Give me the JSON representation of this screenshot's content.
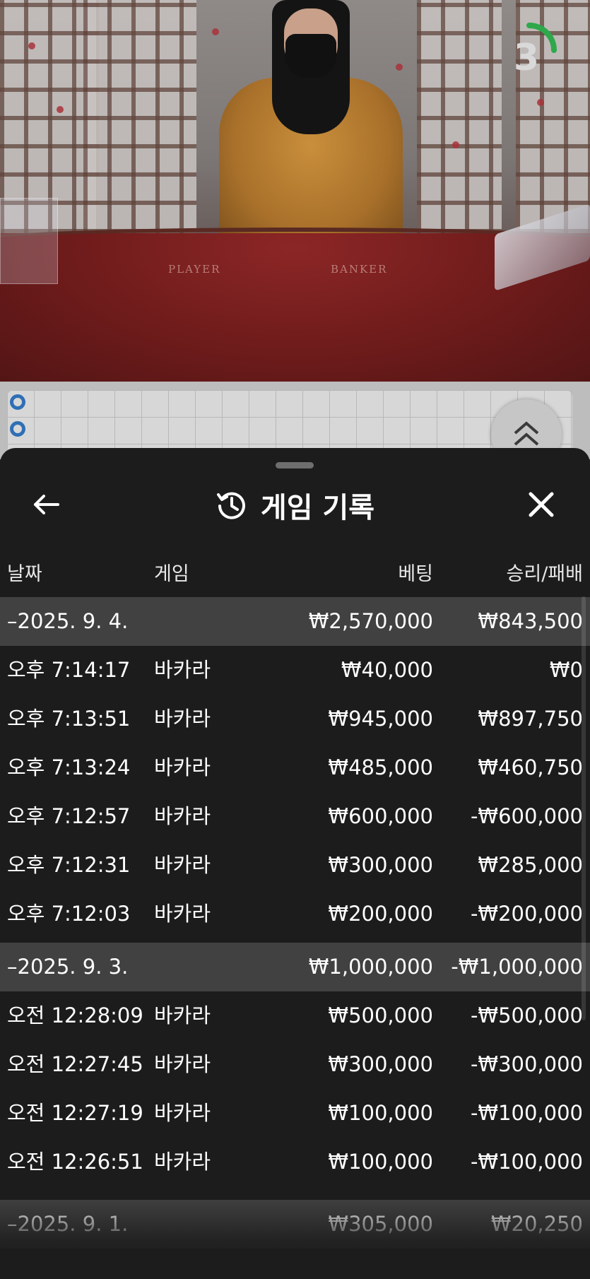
{
  "video": {
    "table_labels": {
      "player": "PLAYER",
      "banker": "BANKER"
    },
    "countdown": "3",
    "countdown_color": "#2ea84a"
  },
  "sheet": {
    "title": "게임 기록",
    "icons": {
      "back": "arrow-left-icon",
      "history": "history-clock-icon",
      "close": "close-icon",
      "expand": "chevron-double-up-icon"
    },
    "columns": {
      "date": "날짜",
      "game": "게임",
      "bet": "베팅",
      "result": "승리/패배"
    },
    "groups": [
      {
        "date": "–2025. 9. 4.",
        "bet_total": "₩2,570,000",
        "result_total": "₩843,500",
        "rows": [
          {
            "time": "오후 7:14:17",
            "game": "바카라",
            "bet": "₩40,000",
            "result": "₩0"
          },
          {
            "time": "오후 7:13:51",
            "game": "바카라",
            "bet": "₩945,000",
            "result": "₩897,750"
          },
          {
            "time": "오후 7:13:24",
            "game": "바카라",
            "bet": "₩485,000",
            "result": "₩460,750"
          },
          {
            "time": "오후 7:12:57",
            "game": "바카라",
            "bet": "₩600,000",
            "result": "-₩600,000"
          },
          {
            "time": "오후 7:12:31",
            "game": "바카라",
            "bet": "₩300,000",
            "result": "₩285,000"
          },
          {
            "time": "오후 7:12:03",
            "game": "바카라",
            "bet": "₩200,000",
            "result": "-₩200,000"
          }
        ]
      },
      {
        "date": "–2025. 9. 3.",
        "bet_total": "₩1,000,000",
        "result_total": "-₩1,000,000",
        "rows": [
          {
            "time": "오전 12:28:09",
            "game": "바카라",
            "bet": "₩500,000",
            "result": "-₩500,000"
          },
          {
            "time": "오전 12:27:45",
            "game": "바카라",
            "bet": "₩300,000",
            "result": "-₩300,000"
          },
          {
            "time": "오전 12:27:19",
            "game": "바카라",
            "bet": "₩100,000",
            "result": "-₩100,000"
          },
          {
            "time": "오전 12:26:51",
            "game": "바카라",
            "bet": "₩100,000",
            "result": "-₩100,000"
          }
        ]
      },
      {
        "date": "–2025. 9. 1.",
        "bet_total": "₩305,000",
        "result_total": "₩20,250",
        "rows": []
      }
    ]
  }
}
